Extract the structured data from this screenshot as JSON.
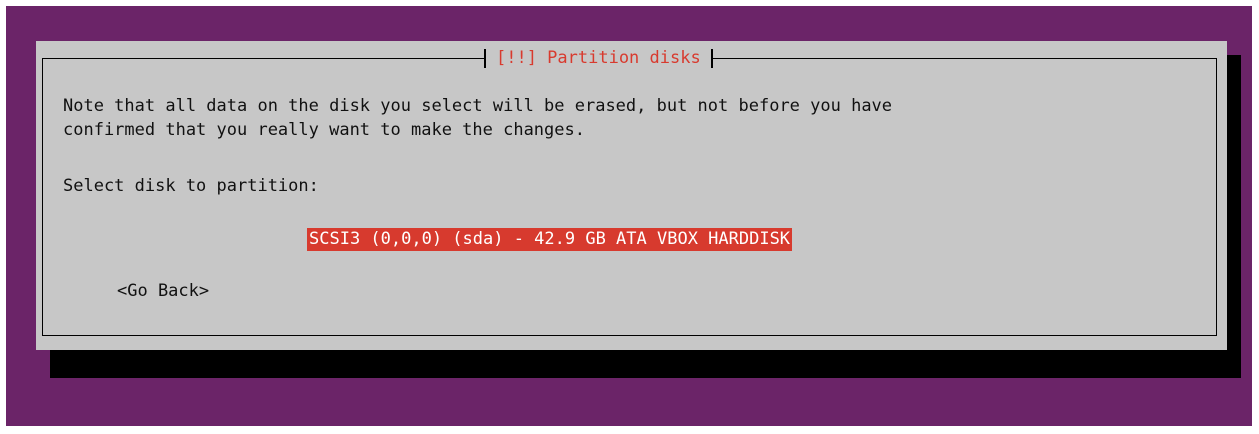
{
  "dialog": {
    "title": "[!!] Partition disks",
    "message_line1": "Note that all data on the disk you select will be erased, but not before you have",
    "message_line2": "confirmed that you really want to make the changes.",
    "prompt": "Select disk to partition:",
    "selected_disk": "SCSI3 (0,0,0) (sda) - 42.9 GB ATA VBOX HARDDISK",
    "go_back_label": "<Go Back>"
  },
  "colors": {
    "background": "#6b2468",
    "dialog": "#c7c7c7",
    "accent": "#d73a2e",
    "shadow": "#000000"
  }
}
